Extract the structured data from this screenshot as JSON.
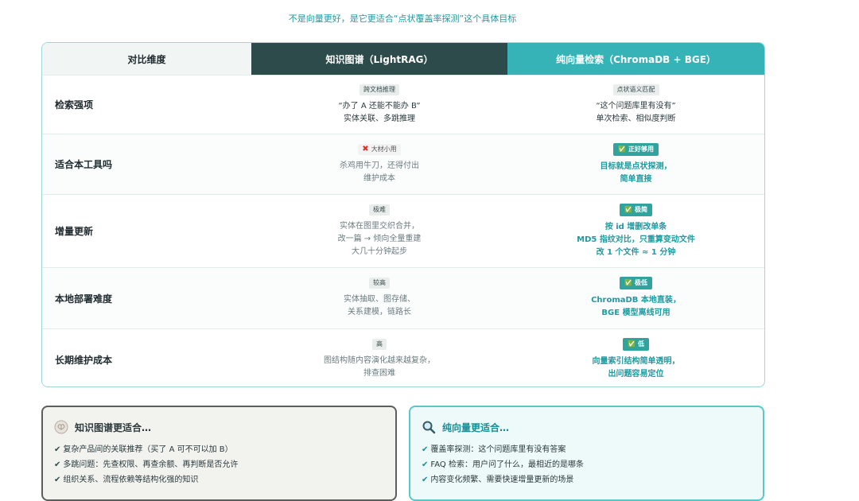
{
  "subtitle": "不是向量更好，是它更适合“点状覆盖率探测”这个具体目标",
  "table": {
    "headers": {
      "dimension": "对比维度",
      "kg": "知识图谱（LightRAG）",
      "vec": "纯向量检索（ChromaDB + BGE）"
    },
    "rows": [
      {
        "dimension": "检索强项",
        "kg": {
          "tag": "跨文档推理",
          "line1": "“办了 A 还能不能办 B”",
          "line2": "实体关联、多跳推理",
          "line3": ""
        },
        "vec": {
          "tag": "点状语义匹配",
          "line1": "“这个问题库里有没有”",
          "line2": "单次检索、相似度判断",
          "line3": ""
        }
      },
      {
        "dimension": "适合本工具吗",
        "kg": {
          "tag": "大材小用",
          "line1": "杀鸡用牛刀，还得付出",
          "line2": "维护成本",
          "line3": ""
        },
        "vec": {
          "tag": "正好够用",
          "line1": "目标就是点状探测，",
          "line2": "简单直接",
          "line3": ""
        }
      },
      {
        "dimension": "增量更新",
        "kg": {
          "tag": "极难",
          "line1": "实体在图里交织合并，",
          "line2": "改一篇 → 倾向全量重建",
          "line3": "大几十分钟起步"
        },
        "vec": {
          "tag": "极简",
          "line1": "按 id 增删改单条",
          "line2": "MD5 指纹对比，只重算变动文件",
          "line3": "改 1 个文件 ≈ 1 分钟"
        }
      },
      {
        "dimension": "本地部署难度",
        "kg": {
          "tag": "较高",
          "line1": "实体抽取、图存储、",
          "line2": "关系建模，链路长",
          "line3": ""
        },
        "vec": {
          "tag": "极低",
          "line1": "ChromaDB 本地直装，",
          "line2": "BGE 模型离线可用",
          "line3": ""
        }
      },
      {
        "dimension": "长期维护成本",
        "kg": {
          "tag": "高",
          "line1": "图结构随内容演化越来越复杂，",
          "line2": "排查困难",
          "line3": ""
        },
        "vec": {
          "tag": "低",
          "line1": "向量索引结构简单透明，",
          "line2": "出问题容易定位",
          "line3": ""
        }
      }
    ]
  },
  "cards": {
    "kg": {
      "title": "知识图谱更适合…",
      "icon": "brain-icon",
      "items": [
        "复杂产品间的关联推荐（买了 A 可不可以加 B）",
        "多跳问题：先查权限、再查余额、再判断是否允许",
        "组织关系、流程依赖等结构化强的知识"
      ]
    },
    "vec": {
      "title": "纯向量更适合…",
      "icon": "magnifier-icon",
      "items": [
        "覆盖率探测：这个问题库里有没有答案",
        "FAQ 检索：用户问了什么，最相近的是哪条",
        "内容变化频繁、需要快速增量更新的场景"
      ]
    }
  },
  "colors": {
    "accent": "#35b3b7",
    "dark_header": "#2e4b4b",
    "good_tag": "#2fa39d",
    "bad_icon": "#d9352b"
  }
}
